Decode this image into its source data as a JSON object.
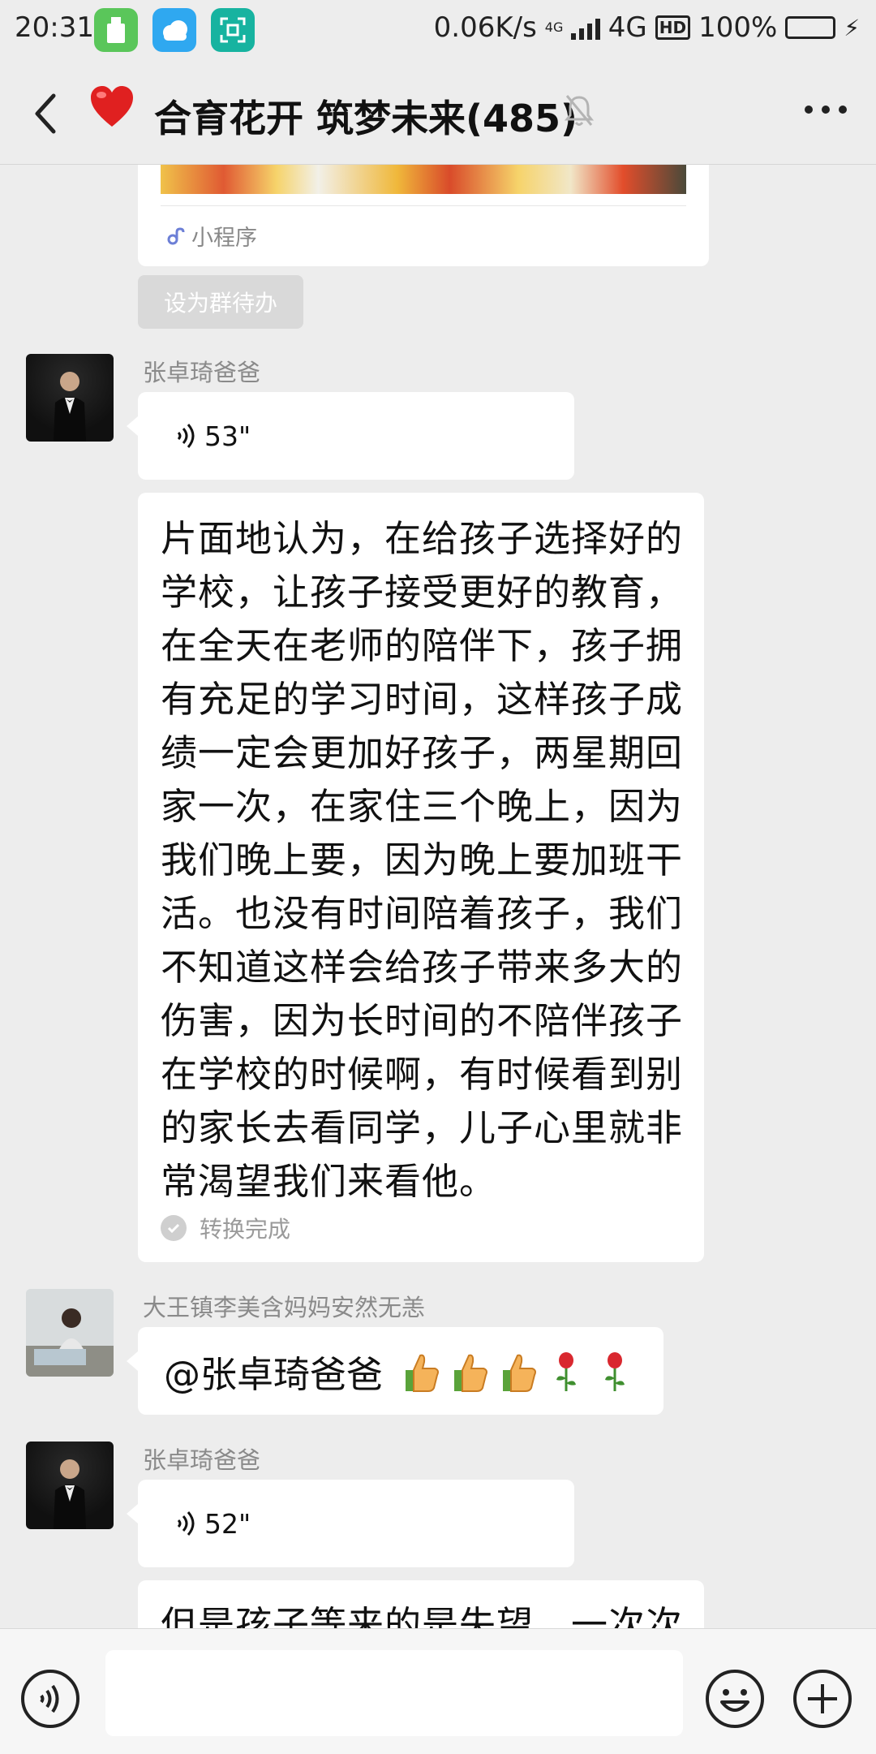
{
  "status_bar": {
    "time": "20:31",
    "net_speed": "0.06K/s",
    "network_small": "4G",
    "network": "4G",
    "hd_label": "HD",
    "battery": "100%",
    "battery_level": 1.0
  },
  "header": {
    "title": "合育花开 筑梦未来(485)",
    "back_icon": "back-arrow-icon",
    "title_icon": "heart-icon",
    "mute_icon": "bell-off-icon",
    "more_icon": "more-dots-icon"
  },
  "messages": {
    "mini_program_label": "小程序",
    "todo_button": "设为群待办",
    "msg1": {
      "sender": "张卓琦爸爸",
      "voice_duration": "53\""
    },
    "msg2": {
      "text": "片面地认为，在给孩子选择好的学校，让孩子接受更好的教育，在全天在老师的陪伴下，孩子拥有充足的学习时间，这样孩子成绩一定会更加好孩子，两星期回家一次，在家住三个晚上，因为我们晚上要，因为晚上要加班干活。也没有时间陪着孩子，我们不知道这样会给孩子带来多大的伤害，因为长时间的不陪伴孩子在学校的时候啊，有时候看到别的家长去看同学，儿子心里就非常渴望我们来看他。",
      "status": "转换完成"
    },
    "msg3": {
      "sender": "大王镇李美含妈妈安然无恙",
      "text": "@张卓琦爸爸"
    },
    "msg4": {
      "sender": "张卓琦爸爸",
      "voice_duration": "52\""
    },
    "msg5": {
      "text_partial": "但是孩子等来的是失望，一次次"
    }
  },
  "input_bar": {
    "voice_icon": "voice-mode-icon",
    "emoji_icon": "emoji-icon",
    "plus_icon": "plus-icon"
  },
  "colors": {
    "background": "#ededed",
    "bubble": "#ffffff",
    "accent_green": "#3cbf4a",
    "heart": "#e02020"
  }
}
